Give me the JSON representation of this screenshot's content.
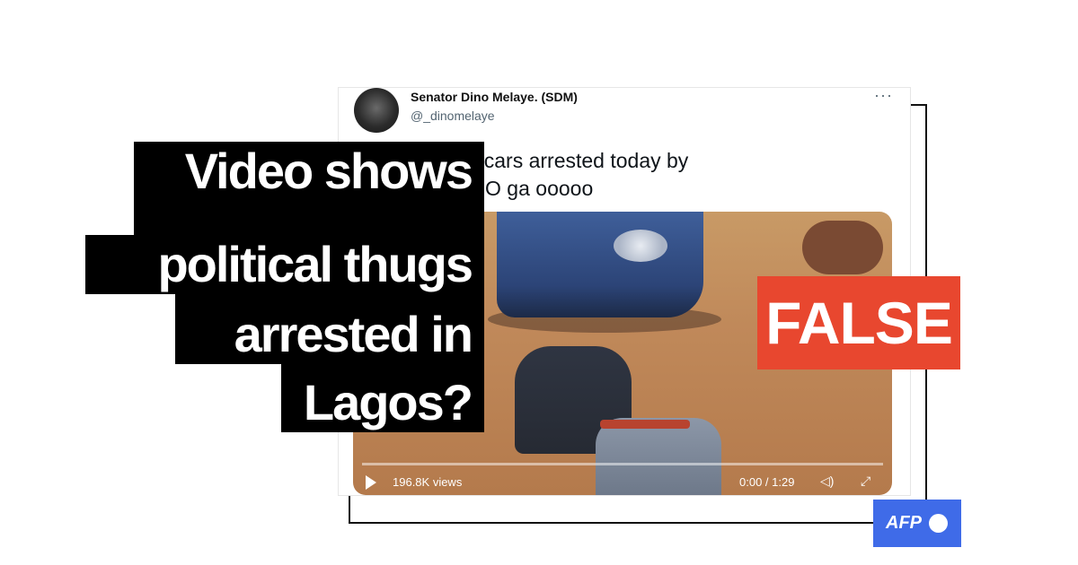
{
  "tweet": {
    "author_name": "Senator Dino Melaye. (SDM)",
    "author_handle": "@_dinomelaye",
    "more_icon": "more-dots-icon",
    "text": "n Apc crested cars arrested today by\ncies in Lagos. O ga ooooo",
    "video": {
      "views": "196.8K views",
      "time": "0:00 / 1:29",
      "play_icon": "play-icon",
      "volume_icon": "volume-icon",
      "fullscreen_icon": "fullscreen-icon"
    }
  },
  "headline": {
    "line1": "Video shows",
    "line2": "political thugs",
    "line3": "arrested in",
    "line4": "Lagos?"
  },
  "verdict": {
    "label": "FALSE",
    "color": "#e8472f"
  },
  "brand": {
    "logo_text": "AFP",
    "color": "#3f6be8"
  }
}
